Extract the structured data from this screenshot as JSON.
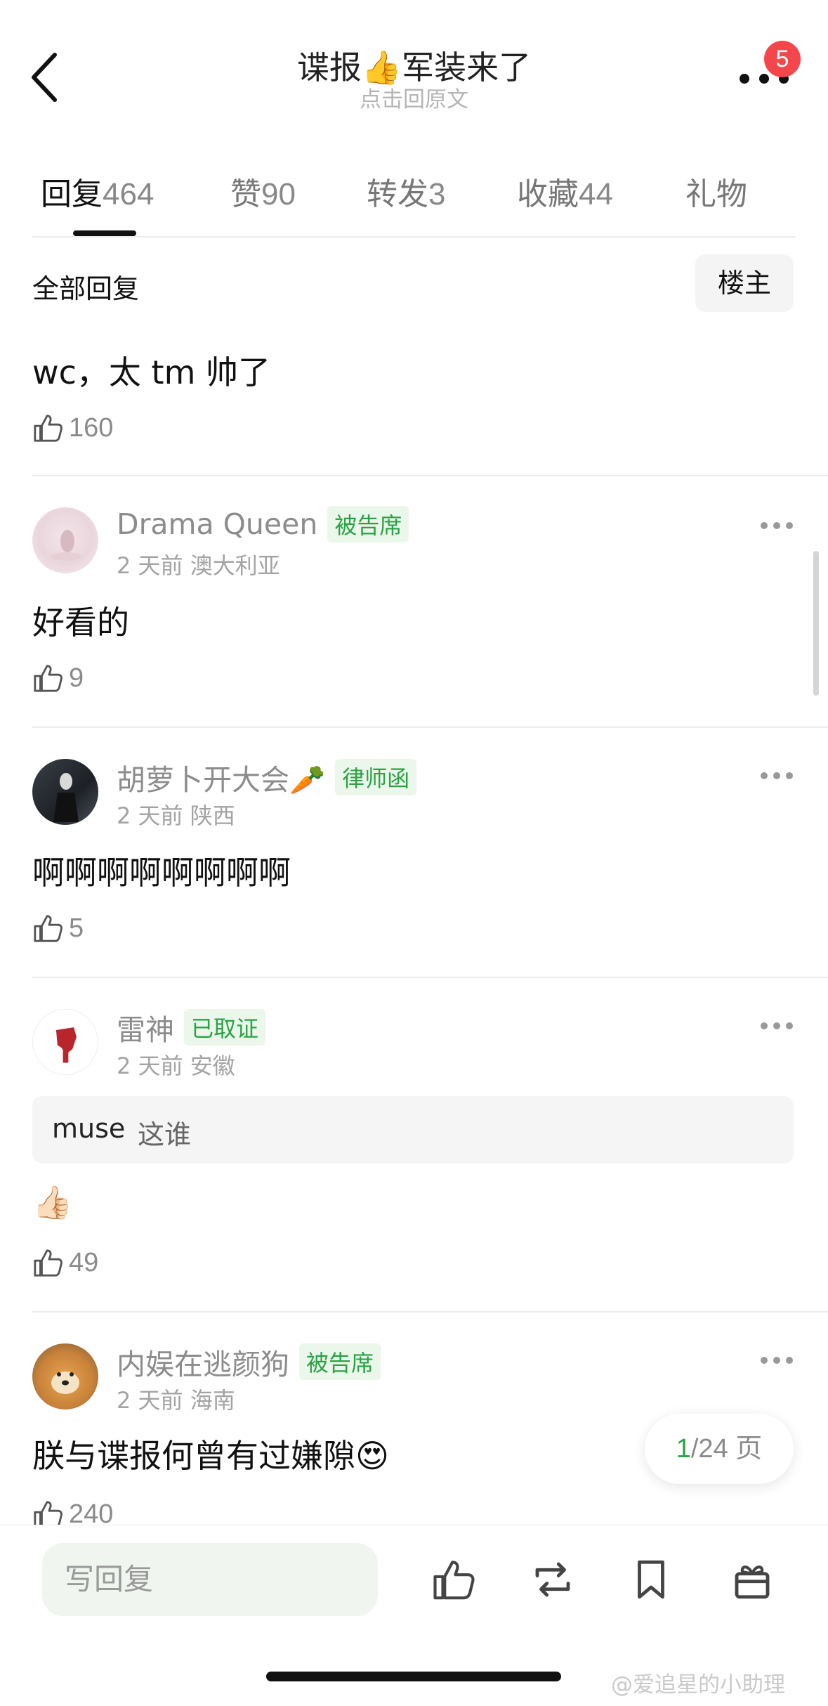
{
  "header": {
    "title": "谍报👍军装来了",
    "subtitle": "点击回原文",
    "badge": "5"
  },
  "tabs": [
    {
      "label": "回复",
      "count": "464"
    },
    {
      "label": "赞",
      "count": "90"
    },
    {
      "label": "转发",
      "count": "3"
    },
    {
      "label": "收藏",
      "count": "44"
    },
    {
      "label": "礼物",
      "count": ""
    }
  ],
  "filter": {
    "label": "全部回复",
    "button": "楼主"
  },
  "comments": [
    {
      "text": "wc，太 tm 帅了",
      "likes": "160"
    },
    {
      "user": "Drama Queen",
      "tag": "被告席",
      "time": "2 天前",
      "location": "澳大利亚",
      "text": "好看的",
      "likes": "9"
    },
    {
      "user": "胡萝卜开大会🥕",
      "tag": "律师函",
      "time": "2 天前",
      "location": "陕西",
      "text": "啊啊啊啊啊啊啊啊",
      "likes": "5"
    },
    {
      "user": "雷神",
      "tag": "已取证",
      "time": "2 天前",
      "location": "安徽",
      "quote_user": "muse",
      "quote_text": "这谁",
      "text": "👍🏻",
      "likes": "49"
    },
    {
      "user": "内娱在逃颜狗",
      "tag": "被告席",
      "time": "2 天前",
      "location": "海南",
      "text": "朕与谍报何曾有过嫌隙😍",
      "likes": "240"
    }
  ],
  "pagination": {
    "current": "1",
    "total": "/24 页"
  },
  "bottom_bar": {
    "reply_placeholder": "写回复"
  },
  "watermark": "@爱追星的小助理",
  "colors": {
    "accent_green": "#2ba245",
    "badge_red": "#f5474b"
  },
  "icons": [
    "back-icon",
    "more-icon",
    "thumbs-up-icon",
    "repost-icon",
    "bookmark-icon",
    "gift-icon"
  ]
}
